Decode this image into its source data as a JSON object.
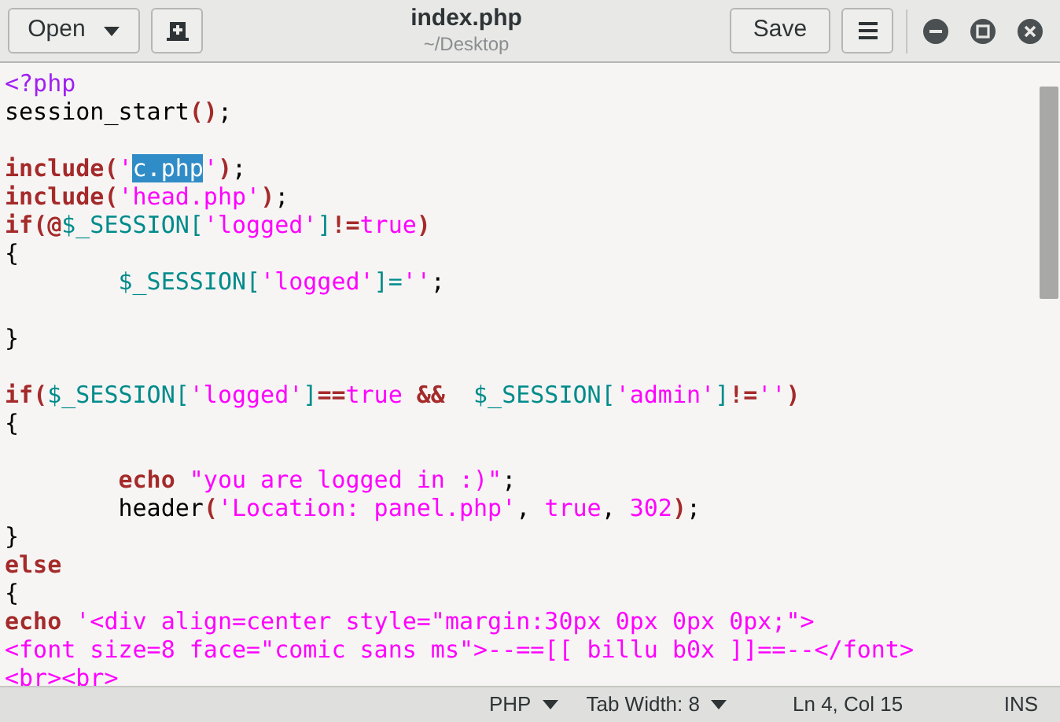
{
  "header": {
    "open_button": "Open",
    "title": "index.php",
    "subtitle": "~/Desktop",
    "save_button": "Save"
  },
  "lines": [
    {
      "kind": "code",
      "tokens": [
        {
          "kind": "tag",
          "text": "<?php"
        }
      ]
    },
    {
      "kind": "code",
      "tokens": [
        {
          "kind": "plain",
          "text": "session_start"
        },
        {
          "kind": "punct",
          "text": "()"
        },
        {
          "kind": "plain",
          "text": ";"
        }
      ]
    },
    {
      "kind": "blank"
    },
    {
      "kind": "code",
      "tokens": [
        {
          "kind": "keyword",
          "text": "include"
        },
        {
          "kind": "punct",
          "text": "("
        },
        {
          "kind": "string",
          "text": "'"
        },
        {
          "kind": "selection",
          "text": "c.php"
        },
        {
          "kind": "string",
          "text": "'"
        },
        {
          "kind": "punct",
          "text": ")"
        },
        {
          "kind": "plain",
          "text": ";"
        }
      ]
    },
    {
      "kind": "code",
      "tokens": [
        {
          "kind": "keyword",
          "text": "include"
        },
        {
          "kind": "punct",
          "text": "("
        },
        {
          "kind": "string",
          "text": "'head.php'"
        },
        {
          "kind": "punct",
          "text": ")"
        },
        {
          "kind": "plain",
          "text": ";"
        }
      ]
    },
    {
      "kind": "code",
      "tokens": [
        {
          "kind": "keyword",
          "text": "if"
        },
        {
          "kind": "punct",
          "text": "(@"
        },
        {
          "kind": "variable",
          "text": "$_SESSION["
        },
        {
          "kind": "string",
          "text": "'logged'"
        },
        {
          "kind": "variable",
          "text": "]"
        },
        {
          "kind": "punct",
          "text": "!="
        },
        {
          "kind": "string",
          "text": "true"
        },
        {
          "kind": "punct",
          "text": ")"
        }
      ]
    },
    {
      "kind": "code",
      "tokens": [
        {
          "kind": "plain",
          "text": "{"
        }
      ]
    },
    {
      "kind": "code",
      "indented": true,
      "tokens": [
        {
          "kind": "variable",
          "text": "$_SESSION["
        },
        {
          "kind": "string",
          "text": "'logged'"
        },
        {
          "kind": "variable",
          "text": "]="
        },
        {
          "kind": "string",
          "text": "''"
        },
        {
          "kind": "plain",
          "text": ";"
        }
      ]
    },
    {
      "kind": "blank"
    },
    {
      "kind": "code",
      "tokens": [
        {
          "kind": "plain",
          "text": "}"
        }
      ]
    },
    {
      "kind": "blank"
    },
    {
      "kind": "code",
      "tokens": [
        {
          "kind": "keyword",
          "text": "if"
        },
        {
          "kind": "punct",
          "text": "("
        },
        {
          "kind": "variable",
          "text": "$_SESSION["
        },
        {
          "kind": "string",
          "text": "'logged'"
        },
        {
          "kind": "variable",
          "text": "]"
        },
        {
          "kind": "punct",
          "text": "=="
        },
        {
          "kind": "string",
          "text": "true"
        },
        {
          "kind": "punct",
          "text": " &&"
        },
        {
          "kind": "variable",
          "text": "  $_SESSION["
        },
        {
          "kind": "string",
          "text": "'admin'"
        },
        {
          "kind": "variable",
          "text": "]"
        },
        {
          "kind": "punct",
          "text": "!="
        },
        {
          "kind": "string",
          "text": "''"
        },
        {
          "kind": "punct",
          "text": ")"
        }
      ]
    },
    {
      "kind": "code",
      "tokens": [
        {
          "kind": "plain",
          "text": "{"
        }
      ]
    },
    {
      "kind": "blank"
    },
    {
      "kind": "code",
      "indented": true,
      "tokens": [
        {
          "kind": "keyword",
          "text": "echo"
        },
        {
          "kind": "string",
          "text": " \"you are logged in :)\""
        },
        {
          "kind": "plain",
          "text": ";"
        }
      ]
    },
    {
      "kind": "code",
      "tokens": [
        {
          "kind": "plain",
          "text": "\theader"
        },
        {
          "kind": "punct",
          "text": "("
        },
        {
          "kind": "string",
          "text": "'Location: panel.php'"
        },
        {
          "kind": "plain",
          "text": ", "
        },
        {
          "kind": "string",
          "text": "true"
        },
        {
          "kind": "plain",
          "text": ", "
        },
        {
          "kind": "string",
          "text": "302"
        },
        {
          "kind": "punct",
          "text": ")"
        },
        {
          "kind": "plain",
          "text": ";"
        }
      ]
    },
    {
      "kind": "code",
      "tokens": [
        {
          "kind": "plain",
          "text": "}"
        }
      ]
    },
    {
      "kind": "code",
      "tokens": [
        {
          "kind": "keyword",
          "text": "else"
        }
      ]
    },
    {
      "kind": "code",
      "tokens": [
        {
          "kind": "plain",
          "text": "{"
        }
      ]
    },
    {
      "kind": "code",
      "tokens": [
        {
          "kind": "keyword",
          "text": "echo"
        },
        {
          "kind": "string",
          "text": " '<div align=center style=\"margin:30px 0px 0px 0px;\">"
        }
      ]
    },
    {
      "kind": "code",
      "tokens": [
        {
          "kind": "string",
          "text": "<font size=8 face=\"comic sans ms\">--==[[ billu b0x ]]==--</font>"
        }
      ]
    },
    {
      "kind": "code",
      "tokens": [
        {
          "kind": "string",
          "text": "<br><br>"
        }
      ]
    }
  ],
  "status_bar": {
    "language": "PHP",
    "tab_width": "Tab Width: 8",
    "position": "Ln 4, Col 15",
    "mode": "INS"
  }
}
